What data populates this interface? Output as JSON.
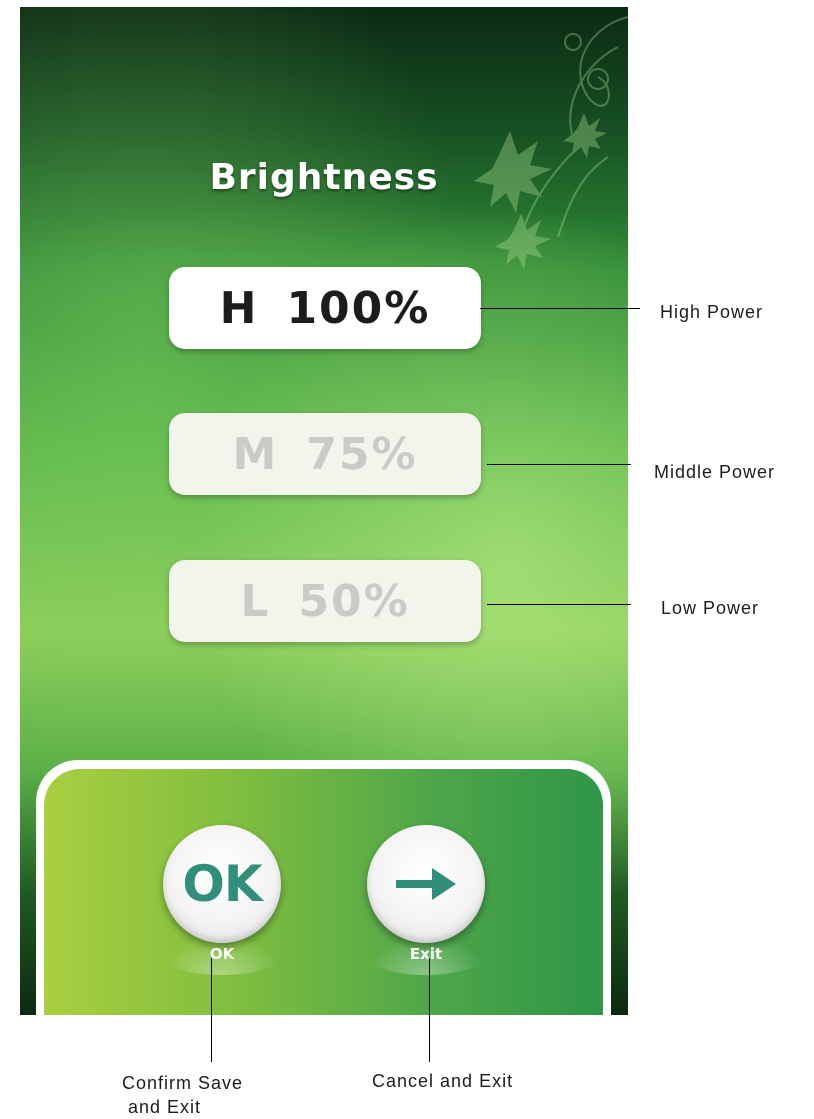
{
  "screen": {
    "title": "Brightness"
  },
  "levels": [
    {
      "letter": "H",
      "value": "100%",
      "state": "selected"
    },
    {
      "letter": "M",
      "value": "75%",
      "state": "unselected"
    },
    {
      "letter": "L",
      "value": "50%",
      "state": "unselected"
    }
  ],
  "buttons": {
    "ok": {
      "glyph": "OK",
      "label": "OK",
      "icon": "ok-icon"
    },
    "exit": {
      "label": "Exit",
      "icon": "arrow-right-icon"
    }
  },
  "annotations": {
    "high": "High Power",
    "middle": "Middle Power",
    "low": "Low Power",
    "confirm_line1": "Confirm Save",
    "confirm_line2": "and Exit",
    "cancel": "Cancel and Exit"
  },
  "colors": {
    "accent_teal": "#2f8f7a",
    "screen_green": "#58b447"
  }
}
